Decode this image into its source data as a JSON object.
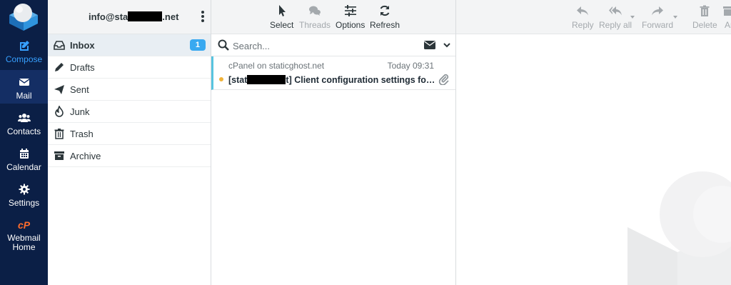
{
  "nav": {
    "compose": "Compose",
    "mail": "Mail",
    "contacts": "Contacts",
    "calendar": "Calendar",
    "settings": "Settings",
    "webmail_home": "Webmail Home"
  },
  "account": {
    "email_prefix": "info@sta",
    "email_suffix": ".net"
  },
  "folders": [
    {
      "label": "Inbox",
      "icon": "inbox-icon",
      "unread": "1",
      "selected": true
    },
    {
      "label": "Drafts",
      "icon": "pencil-icon"
    },
    {
      "label": "Sent",
      "icon": "paper-plane-icon"
    },
    {
      "label": "Junk",
      "icon": "fire-icon"
    },
    {
      "label": "Trash",
      "icon": "trash-icon"
    },
    {
      "label": "Archive",
      "icon": "archive-icon"
    }
  ],
  "list_toolbar": {
    "select": "Select",
    "threads": "Threads",
    "options": "Options",
    "refresh": "Refresh"
  },
  "search": {
    "placeholder": "Search..."
  },
  "messages": [
    {
      "from": "cPanel on staticghost.net",
      "date": "Today 09:31",
      "subject_prefix": "[stat",
      "subject_suffix": "t] Client configuration settings for “i...",
      "unread": true,
      "attachment": true
    }
  ],
  "preview_toolbar": {
    "reply": "Reply",
    "reply_all": "Reply all",
    "forward": "Forward",
    "delete": "Delete",
    "archive": "Ar"
  },
  "colors": {
    "nav_bg": "#0b1f46",
    "accent": "#37a0ff",
    "badge": "#39a9f0",
    "unread_dot": "#f0b33a"
  }
}
